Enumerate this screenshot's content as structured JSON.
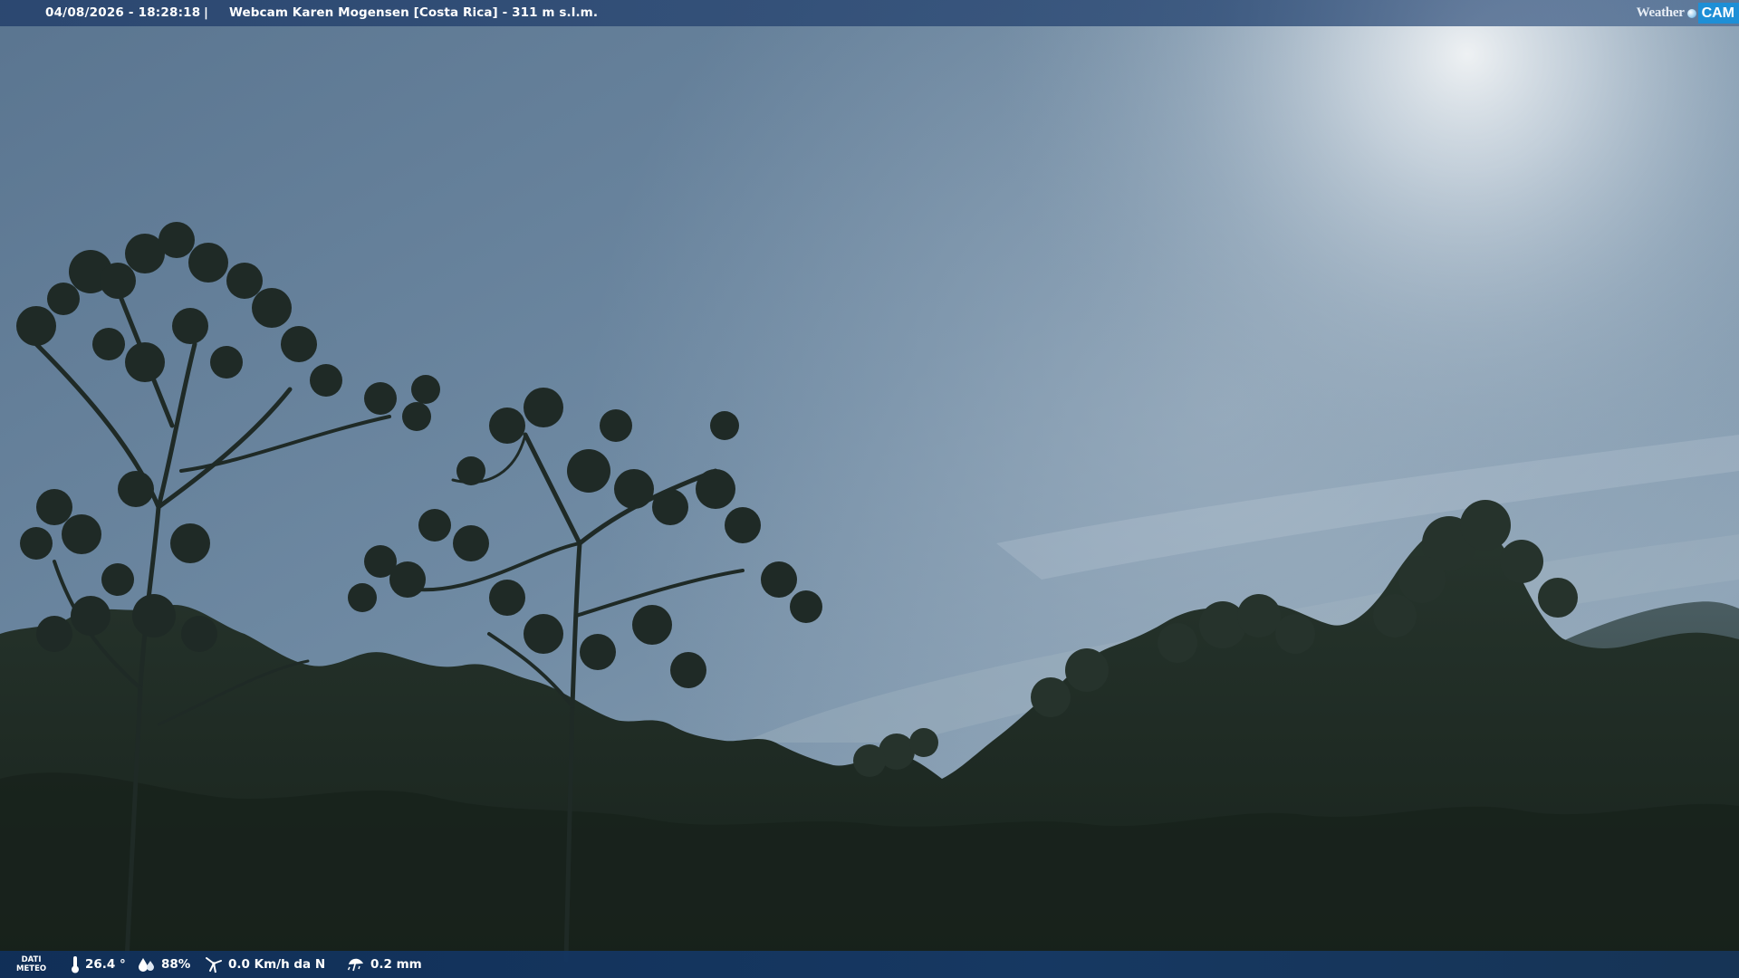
{
  "top_bar": {
    "datetime": "04/08/2026 - 18:28:18",
    "separator": "|",
    "title": "Webcam Karen Mogensen [Costa Rica]  - 311 m s.l.m.",
    "brand_weather": "Weather",
    "brand_cam": "CAM"
  },
  "bottom_bar": {
    "meteo_label_line1": "DATI",
    "meteo_label_line2": "METEO",
    "temperature": "26.4 °",
    "humidity": "88%",
    "wind": "0.0 Km/h da N",
    "rain": "0.2 mm",
    "icons": {
      "temperature": "thermometer-icon",
      "humidity": "humidity-drop-icon",
      "wind": "wind-turbine-icon",
      "rain": "rain-umbrella-icon"
    }
  },
  "colors": {
    "sky_top": "#5e7892",
    "sky_bright": "#d8e2ea",
    "forest_dark": "#1f2b24",
    "bar_top": "#2c4a74",
    "bar_bottom": "#163c6e",
    "brand_blue": "#1e8fd6"
  }
}
